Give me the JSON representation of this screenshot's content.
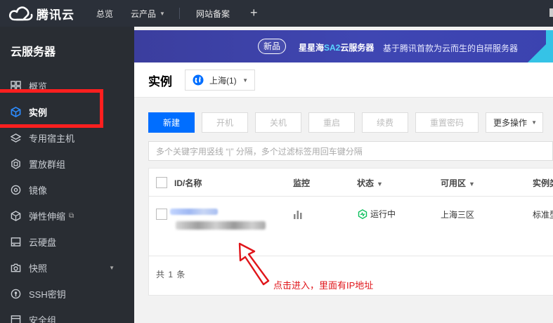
{
  "topbar": {
    "logo_text": "腾讯云",
    "nav": [
      {
        "label": "总览"
      },
      {
        "label": "云产品"
      },
      {
        "label": "网站备案"
      }
    ]
  },
  "sidebar": {
    "title": "云服务器",
    "items": [
      {
        "label": "概览",
        "icon": "grid-icon"
      },
      {
        "label": "实例",
        "icon": "cube-icon",
        "active": true
      },
      {
        "label": "专用宿主机",
        "icon": "layers-icon"
      },
      {
        "label": "置放群组",
        "icon": "hexagon-icon"
      },
      {
        "label": "镜像",
        "icon": "disc-icon"
      },
      {
        "label": "弹性伸缩",
        "icon": "box-icon"
      },
      {
        "label": "云硬盘",
        "icon": "drive-icon"
      },
      {
        "label": "快照",
        "icon": "camera-icon"
      },
      {
        "label": "SSH密钥",
        "icon": "key-icon"
      },
      {
        "label": "安全组",
        "icon": "shield-icon"
      }
    ]
  },
  "banner": {
    "badge": "新品",
    "title_a": "星星海",
    "title_b": "SA2",
    "title_c": "云服务器",
    "desc": "基于腾讯首款为云而生的自研服务器"
  },
  "page": {
    "title": "实例",
    "region": "上海(1)"
  },
  "toolbar": {
    "new": "新建",
    "start": "开机",
    "stop": "关机",
    "restart": "重启",
    "renew": "续费",
    "reset_password": "重置密码",
    "more": "更多操作"
  },
  "search": {
    "placeholder": "多个关键字用竖线 “|” 分隔，多个过滤标签用回车键分隔"
  },
  "table": {
    "columns": {
      "id_name": "ID/名称",
      "monitor": "监控",
      "status": "状态",
      "zone": "可用区",
      "type": "实例类"
    },
    "rows": [
      {
        "status": "运行中",
        "zone": "上海三区",
        "type": "标准型"
      }
    ],
    "footer": "共 1 条"
  },
  "annotation": {
    "text": "点击进入，里面有IP地址",
    "color": "#e0151a"
  },
  "colors": {
    "primary": "#006eff",
    "topbar": "#2b3039",
    "sidebar": "#292d33",
    "running": "#0abf5b"
  }
}
